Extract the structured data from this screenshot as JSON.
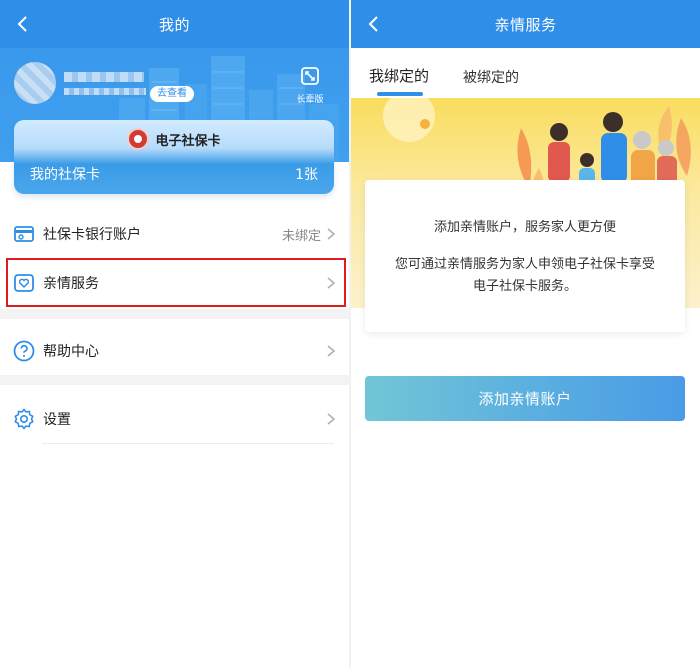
{
  "left": {
    "header": {
      "title": "我的"
    },
    "profile": {
      "view_button": "去查看",
      "elder_mode_label": "长辈版"
    },
    "card": {
      "name": "电子社保卡",
      "label": "我的社保卡",
      "count": "1张"
    },
    "menu": [
      {
        "label": "社保卡银行账户",
        "value": "未绑定",
        "icon": "bank-card-icon"
      },
      {
        "label": "亲情服务",
        "icon": "heart-icon",
        "highlighted": true
      },
      {
        "label": "帮助中心",
        "icon": "help-icon"
      },
      {
        "label": "设置",
        "icon": "gear-icon"
      }
    ]
  },
  "right": {
    "header": {
      "title": "亲情服务"
    },
    "tabs": [
      {
        "label": "我绑定的",
        "active": true
      },
      {
        "label": "被绑定的",
        "active": false
      }
    ],
    "info": {
      "heading": "添加亲情账户，服务家人更方便",
      "body": "您可通过亲情服务为家人申领电子社保卡享受电子社保卡服务。"
    },
    "add_button": "添加亲情账户"
  },
  "colors": {
    "primary": "#2f8ee8",
    "highlight_border": "#e01b1b",
    "banner_yellow": "#f9dd5e",
    "button_start": "#71c6d6",
    "button_end": "#4a9be6"
  }
}
